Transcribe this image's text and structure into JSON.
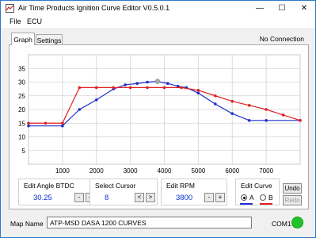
{
  "window": {
    "title": "Air Time Products Ignition Curve Editor V0.5.0.1",
    "min_glyph": "—",
    "max_glyph": "☐",
    "close_glyph": "✕"
  },
  "menu": {
    "items": [
      "File",
      "ECU"
    ]
  },
  "tabs": [
    {
      "label": "Graph",
      "active": true
    },
    {
      "label": "Settings",
      "active": false
    }
  ],
  "connection_status": "No Connection",
  "chart_data": {
    "type": "line",
    "xlim": [
      0,
      8000
    ],
    "ylim": [
      0,
      40
    ],
    "x_ticks": [
      1000,
      2000,
      3000,
      4000,
      5000,
      6000,
      7000
    ],
    "y_ticks": [
      5,
      10,
      15,
      20,
      25,
      30,
      35
    ],
    "grid": true,
    "cursor_point": {
      "x": 3800,
      "y": 30.25
    },
    "series": [
      {
        "color": "#2030d0",
        "x": [
          0,
          1000,
          1500,
          2000,
          2500,
          2850,
          3200,
          3500,
          3800,
          4100,
          4400,
          4650,
          5000,
          5500,
          6000,
          6500,
          7000,
          8000
        ],
        "y": [
          14,
          14,
          20,
          23.5,
          27.5,
          29,
          29.5,
          30,
          30.25,
          29.5,
          28.5,
          28,
          26,
          22,
          18.5,
          16,
          16,
          16
        ]
      },
      {
        "color": "#e02020",
        "x": [
          0,
          500,
          1000,
          1500,
          2000,
          2500,
          3000,
          3500,
          4000,
          4500,
          5000,
          5500,
          6000,
          6500,
          7000,
          7500,
          8000
        ],
        "y": [
          15,
          15,
          15,
          28,
          28,
          28,
          28,
          28,
          28,
          28,
          27,
          25,
          23,
          21.5,
          20,
          18,
          16
        ]
      }
    ]
  },
  "edit_angle": {
    "label": "Edit Angle BTDC",
    "value": "30.25",
    "minus": "-",
    "plus": "+"
  },
  "select_cursor": {
    "label": "Select Cursor",
    "value": "8",
    "prev": "<",
    "next": ">"
  },
  "edit_rpm": {
    "label": "Edit RPM",
    "value": "3800",
    "minus": "-",
    "plus": "+"
  },
  "edit_curve": {
    "label": "Edit Curve",
    "option_a": "A",
    "option_b": "B",
    "selected": "A",
    "color_a": "#2030d0",
    "color_b": "#e02020"
  },
  "undo_label": "Undo",
  "redo_label": "Redo",
  "map_name": {
    "label": "Map Name",
    "value": "ATP-MSD DASA 1200 CURVES"
  },
  "com": {
    "label": "COM1",
    "led_color": "#22c32a"
  }
}
